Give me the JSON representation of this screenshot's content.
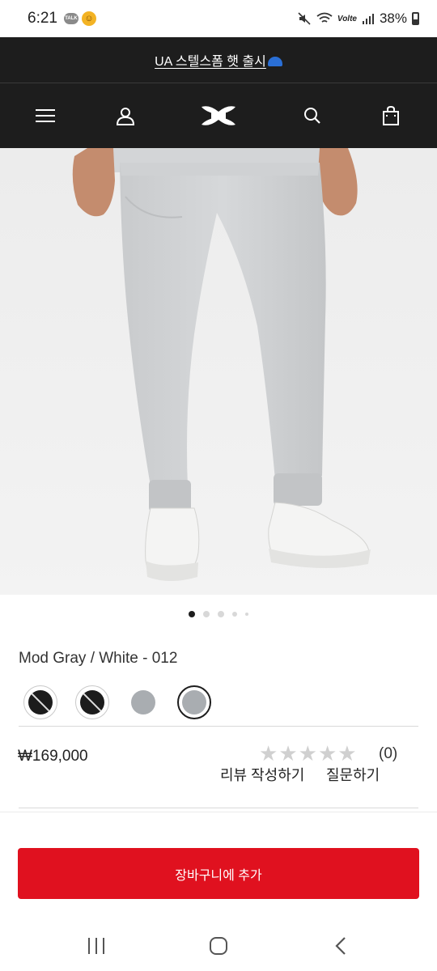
{
  "status_bar": {
    "time": "6:21",
    "talk_badge": "TALK",
    "battery": "38%",
    "network": "Volte"
  },
  "promo": {
    "text": "UA 스텔스폼 햇 출시"
  },
  "nav": {
    "icons": [
      "menu-icon",
      "account-icon",
      "under-armour-logo",
      "search-icon",
      "cart-icon"
    ]
  },
  "product": {
    "image_alt": "product-photo",
    "carousel": {
      "count": 5,
      "active_index": 0
    },
    "color_name": "Mod Gray / White - 012",
    "swatches": [
      {
        "color": "#1c1c1c",
        "style": "dark-slashed",
        "selected": false
      },
      {
        "color": "#1c1c1c",
        "style": "dark-slashed",
        "selected": false
      },
      {
        "color": "#a9adb1",
        "style": "gray",
        "selected": false
      },
      {
        "color": "#a9adb1",
        "style": "gray",
        "selected": true
      }
    ],
    "price": "₩169,000",
    "rating": {
      "stars": 0,
      "max": 5,
      "count_label": "(0)"
    },
    "review_link": "리뷰 작성하기",
    "question_link": "질문하기"
  },
  "cart_button": {
    "label": "장바구니에 추가",
    "color": "#e0111f"
  },
  "system_nav": {
    "icons": [
      "recent-apps-icon",
      "home-icon",
      "back-icon"
    ]
  }
}
